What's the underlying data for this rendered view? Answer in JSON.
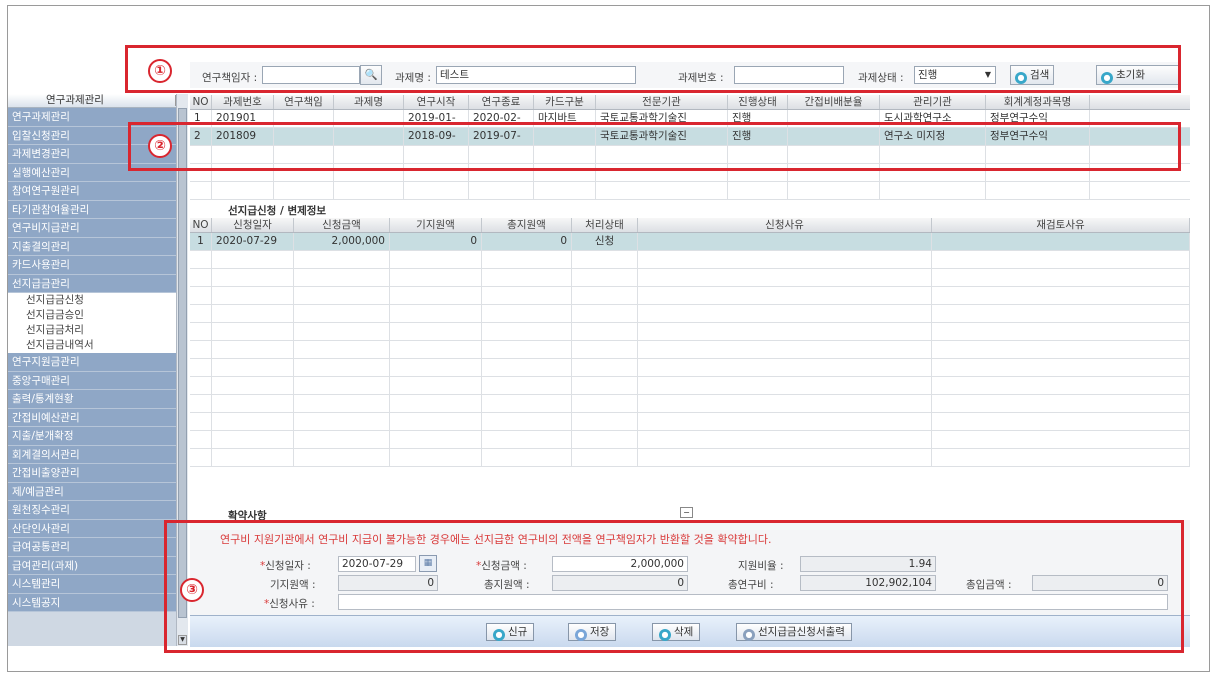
{
  "sidebar": {
    "header": "연구과제관리",
    "items": [
      "연구과제관리",
      "입찰신청관리",
      "과제변경관리",
      "실행예산관리",
      "참여연구원관리",
      "타기관참여율관리",
      "연구비지급관리",
      "지출결의관리",
      "카드사용관리",
      "선지급금관리"
    ],
    "subitems": [
      "선지급금신청",
      "선지급금승인",
      "선지급금처리",
      "선지급금내역서"
    ],
    "items_after": [
      "연구지원금관리",
      "중앙구매관리",
      "출력/통계현황",
      "간접비예산관리",
      "지출/분개확정",
      "회계결의서관리",
      "간접비출양관리",
      "제/예금관리",
      "원천징수관리",
      "산단인사관리",
      "급여공통관리",
      "급여관리(과제)",
      "시스템관리",
      "시스템공지"
    ]
  },
  "search": {
    "researcher_label": "연구책임자 :",
    "researcher_value": "",
    "project_name_label": "과제명 :",
    "project_name_value": "테스트",
    "project_no_label": "과제번호 :",
    "project_no_value": "",
    "status_label": "과제상태 :",
    "status_value": "진행",
    "search_button": "검색",
    "reset_button": "초기화"
  },
  "projects": {
    "columns": [
      "NO",
      "과제번호",
      "연구책임",
      "과제명",
      "연구시작",
      "연구종료",
      "카드구분",
      "전문기관",
      "진행상태",
      "간접비배분율",
      "관리기관",
      "회계계정과목명"
    ],
    "rows": [
      [
        "1",
        "201901",
        "",
        "",
        "2019-01-",
        "2020-02-",
        "마지바트",
        "국토교통과학기술진",
        "진행",
        "",
        "도시과학연구소",
        "정부연구수익"
      ],
      [
        "2",
        "201809",
        "",
        "",
        "2018-09-",
        "2019-07-",
        "",
        "국토교통과학기술진",
        "진행",
        "",
        "연구소 미지정",
        "정부연구수익"
      ]
    ]
  },
  "advance": {
    "title": "선지급신청 / 변제정보",
    "columns": [
      "NO",
      "신청일자",
      "신청금액",
      "기지원액",
      "총지원액",
      "처리상태",
      "신청사유",
      "재검토사유"
    ],
    "rows": [
      [
        "1",
        "2020-07-29",
        "2,000,000",
        "0",
        "0",
        "신청",
        "",
        ""
      ]
    ]
  },
  "form": {
    "section_title": "확약사항",
    "notice": "연구비 지원기관에서 연구비 지급이 불가능한 경우에는 선지급한 연구비의 전액을 연구책임자가 반환할 것을 확약합니다.",
    "apply_date_label": "신청일자 :",
    "apply_date": "2020-07-29",
    "apply_amount_label": "신청금액 :",
    "apply_amount": "2,000,000",
    "support_ratio_label": "지원비율 :",
    "support_ratio": "1.94",
    "prev_support_label": "기지원액 :",
    "prev_support": "0",
    "total_support_label": "총지원액 :",
    "total_support": "0",
    "total_budget_label": "총연구비 :",
    "total_budget": "102,902,104",
    "total_income_label": "총입금액 :",
    "total_income": "0",
    "reason_label": "신청사유 :",
    "reason": ""
  },
  "toolbar": {
    "new": "신규",
    "save": "저장",
    "delete": "삭제",
    "print": "선지급금신청서출력"
  },
  "annotations": [
    "①",
    "②",
    "③"
  ]
}
